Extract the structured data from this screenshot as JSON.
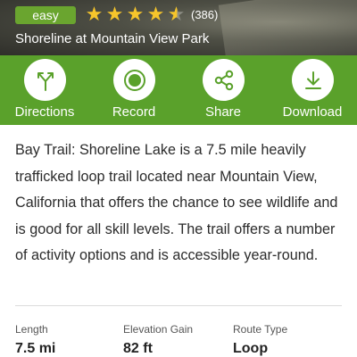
{
  "header": {
    "difficulty": "easy",
    "rating": 4.5,
    "review_count": "(386)",
    "park_name": "Shoreline at Mountain View Park",
    "star_color": "#f6c52b",
    "badge_color": "#6aa52f"
  },
  "actions": [
    {
      "label": "Directions",
      "icon": "directions-icon"
    },
    {
      "label": "Record",
      "icon": "record-icon"
    },
    {
      "label": "Share",
      "icon": "share-icon"
    },
    {
      "label": "Download",
      "icon": "download-icon"
    }
  ],
  "action_bar_color": "#5aa12b",
  "description": "Bay Trail: Shoreline Lake is a 7.5 mile heavily trafficked loop trail located near Mountain View, California that offers the chance to see wildlife and is good for all skill levels. The trail offers a number of activity options and is accessible year-round.",
  "stats": [
    {
      "label": "Length",
      "value": "7.5 mi"
    },
    {
      "label": "Elevation Gain",
      "value": "82 ft"
    },
    {
      "label": "Route Type",
      "value": "Loop"
    }
  ]
}
